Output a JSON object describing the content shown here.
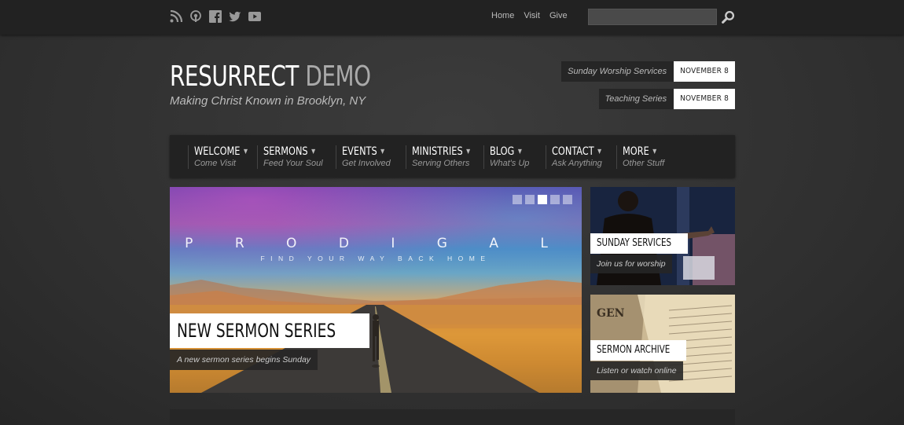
{
  "topbar": {
    "social_icons": [
      "rss-icon",
      "podcast-icon",
      "facebook-icon",
      "twitter-icon",
      "youtube-icon"
    ],
    "links": [
      "Home",
      "Visit",
      "Give"
    ],
    "search": {
      "value": "",
      "placeholder": ""
    }
  },
  "header": {
    "title_main": "RESURRECT",
    "title_accent": "DEMO",
    "tagline": "Making Christ Known in Brooklyn, NY"
  },
  "events": [
    {
      "name": "Sunday Worship Services",
      "date": "NOVEMBER 8"
    },
    {
      "name": "Teaching Series",
      "date": "NOVEMBER 8"
    }
  ],
  "nav": [
    {
      "label": "WELCOME",
      "sub": "Come Visit"
    },
    {
      "label": "SERMONS",
      "sub": "Feed Your Soul"
    },
    {
      "label": "EVENTS",
      "sub": "Get Involved"
    },
    {
      "label": "MINISTRIES",
      "sub": "Serving Others"
    },
    {
      "label": "BLOG",
      "sub": "What's Up"
    },
    {
      "label": "CONTACT",
      "sub": "Ask Anything"
    },
    {
      "label": "MORE",
      "sub": "Other Stuff"
    }
  ],
  "slider": {
    "image_title": "P R O D I G A L",
    "image_subtitle": "FIND YOUR WAY BACK HOME",
    "caption_title": "NEW SERMON SERIES",
    "caption_sub": "A new sermon series begins Sunday",
    "active_slide": 3,
    "slide_count": 5
  },
  "highlights": [
    {
      "title": "SUNDAY SERVICES",
      "sub": "Join us for worship"
    },
    {
      "title": "SERMON ARCHIVE",
      "sub": "Listen or watch online"
    }
  ],
  "colors": {
    "accent": "#ffffff",
    "topbar_bg": "#222222",
    "page_bg": "#343434"
  }
}
